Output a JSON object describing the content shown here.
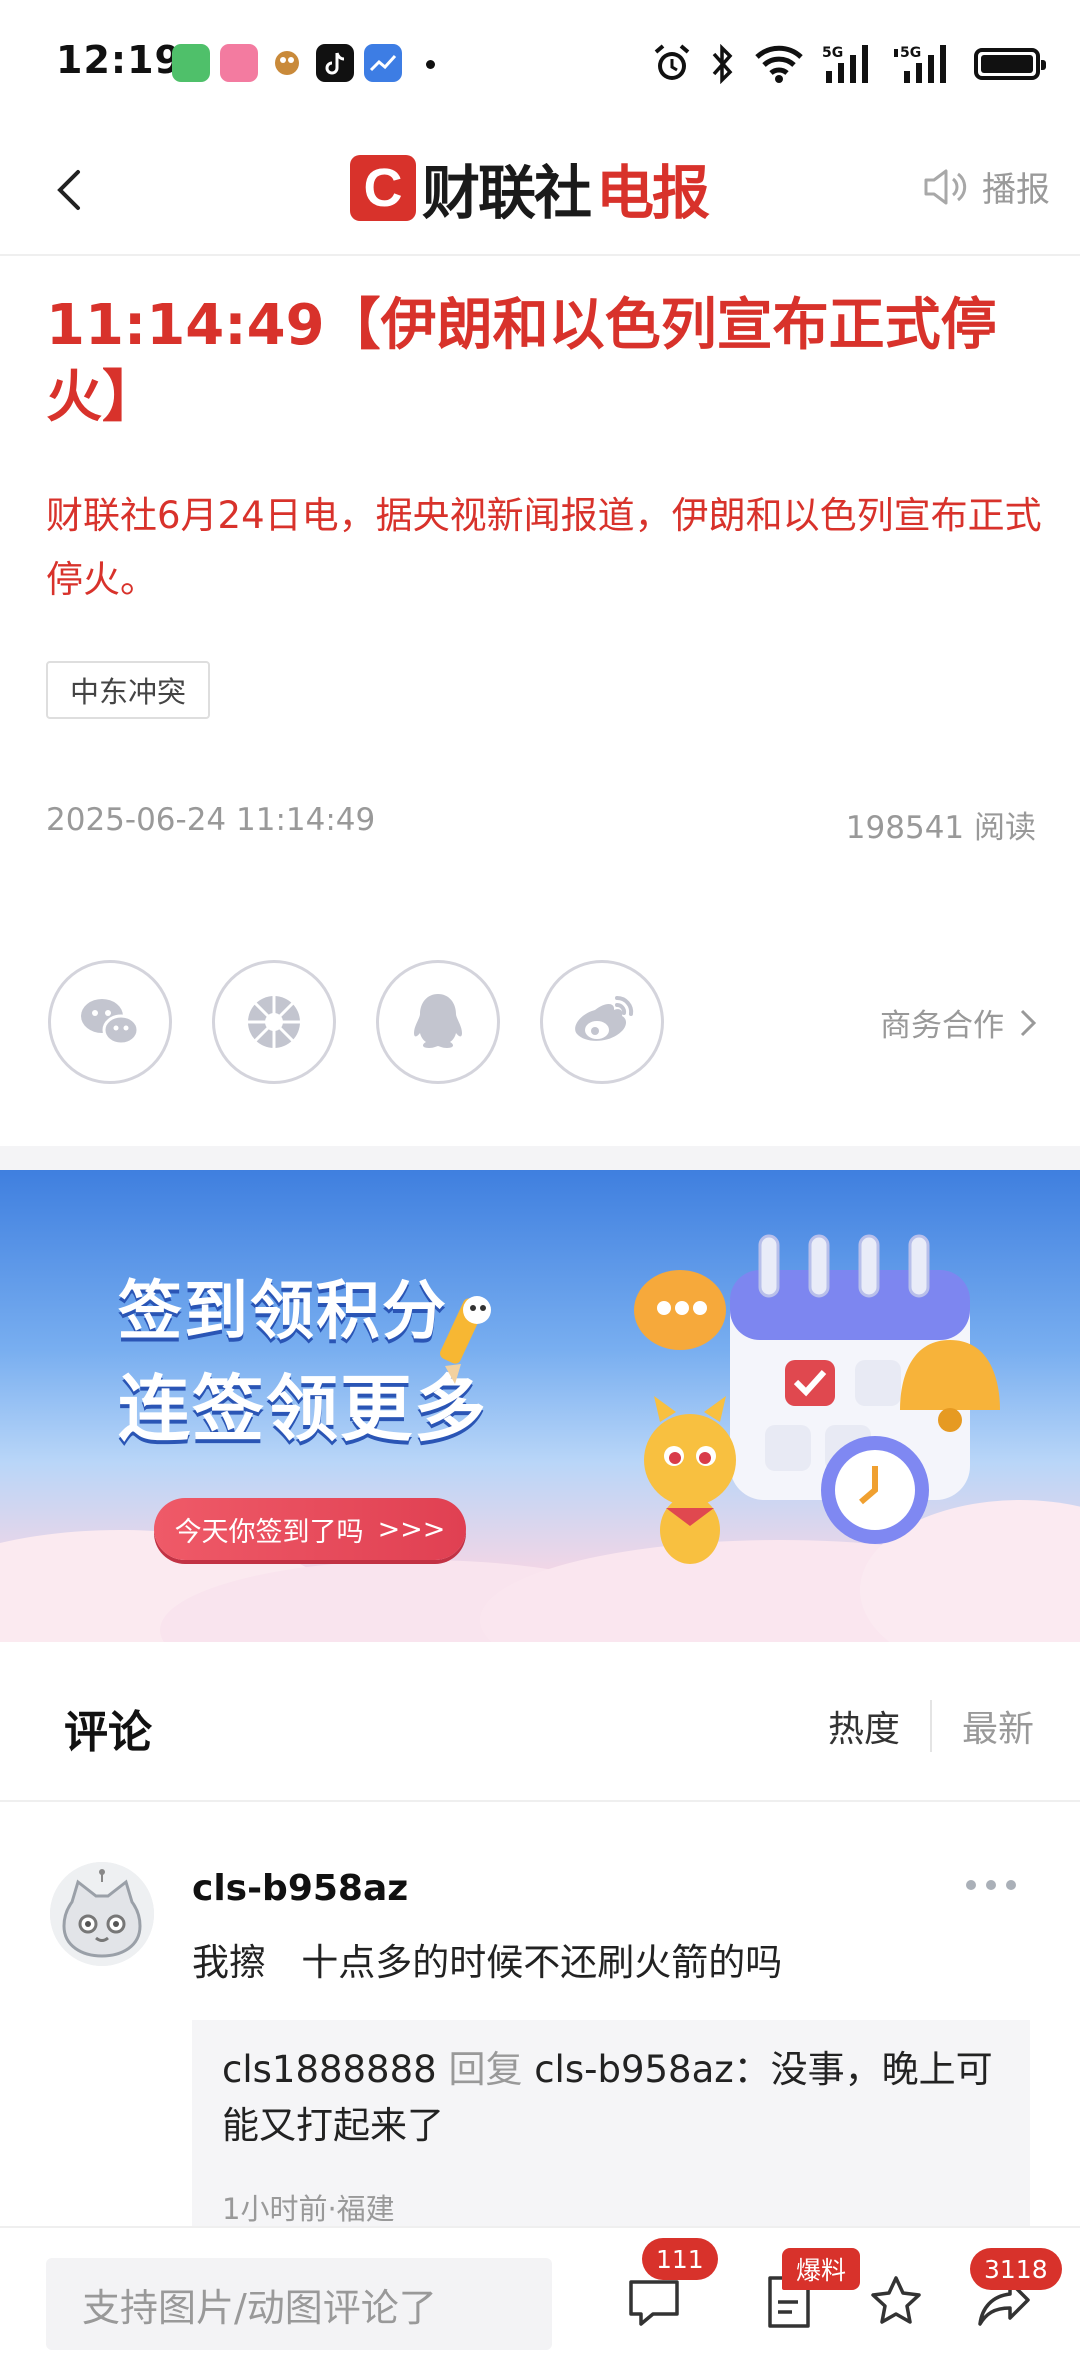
{
  "status_bar": {
    "time": "12:19",
    "apps": [
      "iqiyi",
      "bilibili",
      "game",
      "tiktok",
      "stocks"
    ],
    "network": "5G"
  },
  "header": {
    "logo_c": "C",
    "logo_text_black": "财联社",
    "logo_text_red": "电报",
    "broadcast_label": "播报"
  },
  "article": {
    "title": "11:14:49【伊朗和以色列宣布正式停火】",
    "summary": "财联社6月24日电，据央视新闻报道，伊朗和以色列宣布正式停火。",
    "tag": "中东冲突",
    "datetime": "2025-06-24 11:14:49",
    "read_count": "198541 阅读"
  },
  "share": {
    "icons": [
      "wechat-icon",
      "moments-icon",
      "qq-icon",
      "weibo-icon"
    ],
    "business_label": "商务合作"
  },
  "banner": {
    "line1": "签到领积分",
    "line2": "连签领更多",
    "button_label": "今天你签到了吗",
    "button_arrows": ">>>"
  },
  "comments": {
    "title": "评论",
    "sort_hot": "热度",
    "sort_new": "最新",
    "items": [
      {
        "user": "cls-b958az",
        "text": "我擦   十点多的时候不还刷火箭的吗",
        "reply": {
          "from": "cls1888888",
          "verb": "回复",
          "to": "cls-b958az",
          "text": "：没事，晚上可能又打起来了",
          "meta": "1小时前·福建"
        }
      }
    ]
  },
  "bottom_bar": {
    "placeholder": "支持图片/动图评论了",
    "comment_count": "111",
    "tip_badge": "爆料",
    "share_count": "3118"
  },
  "colors": {
    "accent": "#d8322b",
    "muted": "#999999"
  }
}
